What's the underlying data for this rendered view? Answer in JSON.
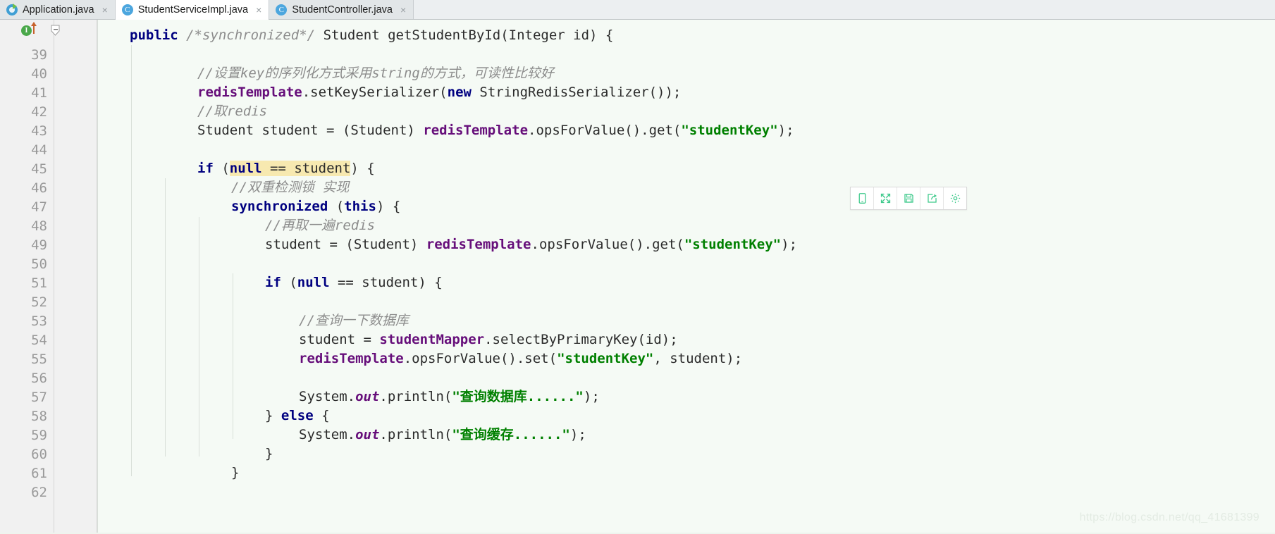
{
  "window": {
    "app": "IntelliJ IDEA Java Editor"
  },
  "tabs": [
    {
      "label": "Application.java",
      "icon": "spring-boot-icon",
      "close": "×",
      "selected": false,
      "icon_letter": ""
    },
    {
      "label": "StudentServiceImpl.java",
      "icon": "java-class-icon",
      "close": "×",
      "selected": true,
      "icon_letter": "C"
    },
    {
      "label": "StudentController.java",
      "icon": "java-class-icon",
      "close": "×",
      "selected": false,
      "icon_letter": "C"
    }
  ],
  "gutter": {
    "first_line_marker": "implements-method-marker",
    "first_line_marker_letter": "I",
    "fold_marker": "fold-collapse-marker"
  },
  "editor": {
    "first_line_number": 39,
    "last_line_number": 62,
    "highlight_text": "null == student",
    "lines": [
      {
        "n": 39,
        "indent": 0,
        "tokens": [
          {
            "t": "public",
            "c": "kw"
          },
          {
            "t": " ",
            "c": "plain"
          },
          {
            "t": "/*synchronized*/",
            "c": "cmt"
          },
          {
            "t": " Student getStudentById(Integer id) {",
            "c": "plain"
          }
        ]
      },
      {
        "n": 40,
        "indent": 0,
        "tokens": []
      },
      {
        "n": 41,
        "indent": 2,
        "tokens": [
          {
            "t": "//设置key的序列化方式采用string的方式，可读性比较好",
            "c": "cmt"
          }
        ]
      },
      {
        "n": 42,
        "indent": 2,
        "tokens": [
          {
            "t": "redisTemplate",
            "c": "fld"
          },
          {
            "t": ".setKeySerializer(",
            "c": "plain"
          },
          {
            "t": "new",
            "c": "kw"
          },
          {
            "t": " StringRedisSerializer());",
            "c": "plain"
          }
        ]
      },
      {
        "n": 43,
        "indent": 2,
        "tokens": [
          {
            "t": "//取redis",
            "c": "cmt"
          }
        ]
      },
      {
        "n": 44,
        "indent": 2,
        "tokens": [
          {
            "t": "Student student = (Student) ",
            "c": "plain"
          },
          {
            "t": "redisTemplate",
            "c": "fld"
          },
          {
            "t": ".opsForValue().get(",
            "c": "plain"
          },
          {
            "t": "\"studentKey\"",
            "c": "str"
          },
          {
            "t": ");",
            "c": "plain"
          }
        ]
      },
      {
        "n": 45,
        "indent": 0,
        "tokens": []
      },
      {
        "n": 46,
        "indent": 2,
        "tokens": [
          {
            "t": "if",
            "c": "kw"
          },
          {
            "t": " (",
            "c": "plain"
          },
          {
            "t": "null",
            "c": "kw hl"
          },
          {
            "t": " == ",
            "c": "plain hl"
          },
          {
            "t": "student",
            "c": "plain hl"
          },
          {
            "t": ") {",
            "c": "plain"
          }
        ]
      },
      {
        "n": 47,
        "indent": 3,
        "tokens": [
          {
            "t": "//双重检测锁 实现",
            "c": "cmt"
          }
        ]
      },
      {
        "n": 48,
        "indent": 3,
        "tokens": [
          {
            "t": "synchronized",
            "c": "kw"
          },
          {
            "t": " (",
            "c": "plain"
          },
          {
            "t": "this",
            "c": "kw"
          },
          {
            "t": ") {",
            "c": "plain"
          }
        ]
      },
      {
        "n": 49,
        "indent": 4,
        "tokens": [
          {
            "t": "//再取一遍redis",
            "c": "cmt"
          }
        ]
      },
      {
        "n": 50,
        "indent": 4,
        "tokens": [
          {
            "t": "student = (Student) ",
            "c": "plain"
          },
          {
            "t": "redisTemplate",
            "c": "fld"
          },
          {
            "t": ".opsForValue().get(",
            "c": "plain"
          },
          {
            "t": "\"studentKey\"",
            "c": "str"
          },
          {
            "t": ");",
            "c": "plain"
          }
        ]
      },
      {
        "n": 51,
        "indent": 0,
        "tokens": []
      },
      {
        "n": 52,
        "indent": 4,
        "tokens": [
          {
            "t": "if",
            "c": "kw"
          },
          {
            "t": " (",
            "c": "plain"
          },
          {
            "t": "null",
            "c": "kw"
          },
          {
            "t": " == student) {",
            "c": "plain"
          }
        ]
      },
      {
        "n": 53,
        "indent": 0,
        "tokens": []
      },
      {
        "n": 54,
        "indent": 5,
        "tokens": [
          {
            "t": "//查询一下数据库",
            "c": "cmt"
          }
        ]
      },
      {
        "n": 55,
        "indent": 5,
        "tokens": [
          {
            "t": "student = ",
            "c": "plain"
          },
          {
            "t": "studentMapper",
            "c": "fld"
          },
          {
            "t": ".selectByPrimaryKey(id);",
            "c": "plain"
          }
        ]
      },
      {
        "n": 56,
        "indent": 5,
        "tokens": [
          {
            "t": "redisTemplate",
            "c": "fld"
          },
          {
            "t": ".opsForValue().set(",
            "c": "plain"
          },
          {
            "t": "\"studentKey\"",
            "c": "str"
          },
          {
            "t": ", student);",
            "c": "plain"
          }
        ]
      },
      {
        "n": 57,
        "indent": 0,
        "tokens": []
      },
      {
        "n": 58,
        "indent": 5,
        "tokens": [
          {
            "t": "System.",
            "c": "plain"
          },
          {
            "t": "out",
            "c": "sfld"
          },
          {
            "t": ".println(",
            "c": "plain"
          },
          {
            "t": "\"查询数据库......\"",
            "c": "str"
          },
          {
            "t": ");",
            "c": "plain"
          }
        ]
      },
      {
        "n": 59,
        "indent": 4,
        "tokens": [
          {
            "t": "} ",
            "c": "plain"
          },
          {
            "t": "else",
            "c": "kw"
          },
          {
            "t": " {",
            "c": "plain"
          }
        ]
      },
      {
        "n": 60,
        "indent": 5,
        "tokens": [
          {
            "t": "System.",
            "c": "plain"
          },
          {
            "t": "out",
            "c": "sfld"
          },
          {
            "t": ".println(",
            "c": "plain"
          },
          {
            "t": "\"查询缓存......\"",
            "c": "str"
          },
          {
            "t": ");",
            "c": "plain"
          }
        ]
      },
      {
        "n": 61,
        "indent": 4,
        "tokens": [
          {
            "t": "}",
            "c": "plain"
          }
        ]
      },
      {
        "n": 62,
        "indent": 3,
        "tokens": [
          {
            "t": "}",
            "c": "plain"
          }
        ]
      }
    ]
  },
  "float_toolbar": {
    "buttons": [
      {
        "name": "mobile-preview-icon",
        "title": "Mobile"
      },
      {
        "name": "fullscreen-expand-icon",
        "title": "Fullscreen"
      },
      {
        "name": "save-icon",
        "title": "Save"
      },
      {
        "name": "share-export-icon",
        "title": "Share"
      },
      {
        "name": "gear-settings-icon",
        "title": "Settings"
      }
    ],
    "accent_color": "#3ec98b"
  },
  "watermark": {
    "text": "https://blog.csdn.net/qq_41681399"
  },
  "colors": {
    "editor_bg": "#f5faf5",
    "gutter_bg": "#f1f1f1",
    "keyword": "#000080",
    "comment": "#8c8c8c",
    "string": "#008000",
    "field": "#660e7a",
    "highlight": "#f7e9b0",
    "tab_selected_bg": "#ffffff",
    "tab_bg": "#e2e6e8"
  }
}
